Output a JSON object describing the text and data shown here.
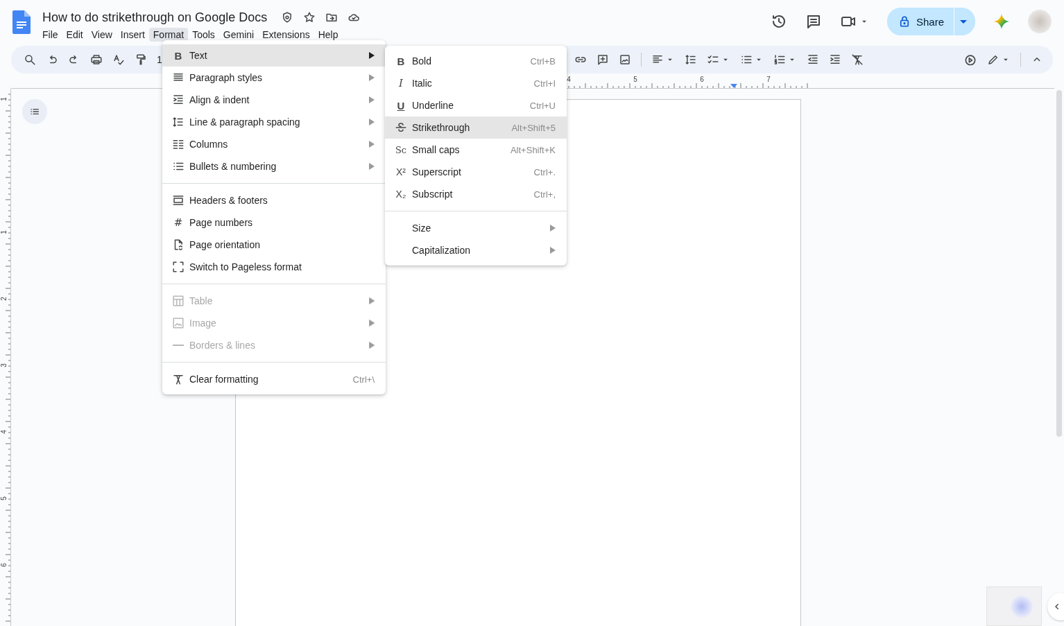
{
  "document": {
    "title": "How to do strikethrough on Google Docs"
  },
  "menubar": [
    {
      "label": "File",
      "selected": false
    },
    {
      "label": "Edit",
      "selected": false
    },
    {
      "label": "View",
      "selected": false
    },
    {
      "label": "Insert",
      "selected": false
    },
    {
      "label": "Format",
      "selected": true
    },
    {
      "label": "Tools",
      "selected": false
    },
    {
      "label": "Gemini",
      "selected": false
    },
    {
      "label": "Extensions",
      "selected": false
    },
    {
      "label": "Help",
      "selected": false
    }
  ],
  "share_button": {
    "label": "Share"
  },
  "toolbar": {
    "zoom_partial": "1"
  },
  "ruler": {
    "horizontal_labels": [
      "4",
      "5",
      "6",
      "7"
    ],
    "vertical_labels": [
      "1",
      "1",
      "2",
      "3",
      "4",
      "5",
      "6"
    ]
  },
  "format_menu": {
    "groups": [
      [
        {
          "label": "Text",
          "glyph": "B",
          "has_submenu": true,
          "selected": true,
          "disabled": false
        },
        {
          "label": "Paragraph styles",
          "has_submenu": true,
          "selected": false,
          "disabled": false
        },
        {
          "label": "Align & indent",
          "has_submenu": true,
          "selected": false,
          "disabled": false
        },
        {
          "label": "Line & paragraph spacing",
          "has_submenu": true,
          "selected": false,
          "disabled": false
        },
        {
          "label": "Columns",
          "has_submenu": true,
          "selected": false,
          "disabled": false
        },
        {
          "label": "Bullets & numbering",
          "has_submenu": true,
          "selected": false,
          "disabled": false
        }
      ],
      [
        {
          "label": "Headers & footers",
          "has_submenu": false,
          "selected": false,
          "disabled": false
        },
        {
          "label": "Page numbers",
          "glyph": "#",
          "has_submenu": false,
          "selected": false,
          "disabled": false
        },
        {
          "label": "Page orientation",
          "has_submenu": false,
          "selected": false,
          "disabled": false
        },
        {
          "label": "Switch to Pageless format",
          "has_submenu": false,
          "selected": false,
          "disabled": false
        }
      ],
      [
        {
          "label": "Table",
          "has_submenu": true,
          "selected": false,
          "disabled": true
        },
        {
          "label": "Image",
          "has_submenu": true,
          "selected": false,
          "disabled": true
        },
        {
          "label": "Borders & lines",
          "has_submenu": true,
          "selected": false,
          "disabled": true
        }
      ],
      [
        {
          "label": "Clear formatting",
          "shortcut": "Ctrl+\\",
          "has_submenu": false,
          "selected": false,
          "disabled": false
        }
      ]
    ]
  },
  "text_submenu": {
    "groups": [
      [
        {
          "label": "Bold",
          "glyph": "B",
          "shortcut": "Ctrl+B",
          "has_submenu": false,
          "selected": false
        },
        {
          "label": "Italic",
          "glyph": "I",
          "shortcut": "Ctrl+I",
          "has_submenu": false,
          "selected": false
        },
        {
          "label": "Underline",
          "glyph": "U",
          "shortcut": "Ctrl+U",
          "has_submenu": false,
          "selected": false
        },
        {
          "label": "Strikethrough",
          "shortcut": "Alt+Shift+5",
          "has_submenu": false,
          "selected": true
        },
        {
          "label": "Small caps",
          "glyph": "Sc",
          "shortcut": "Alt+Shift+K",
          "has_submenu": false,
          "selected": false
        },
        {
          "label": "Superscript",
          "glyph": "X²",
          "shortcut": "Ctrl+.",
          "has_submenu": false,
          "selected": false
        },
        {
          "label": "Subscript",
          "glyph": "X₂",
          "shortcut": "Ctrl+,",
          "has_submenu": false,
          "selected": false
        }
      ],
      [
        {
          "label": "Size",
          "has_submenu": true,
          "selected": false
        },
        {
          "label": "Capitalization",
          "has_submenu": true,
          "selected": false
        }
      ]
    ]
  }
}
